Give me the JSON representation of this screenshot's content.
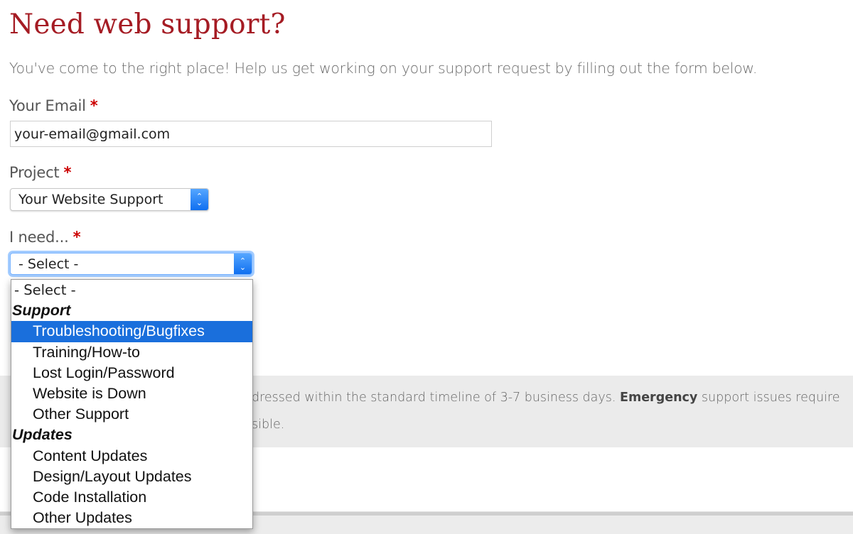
{
  "page": {
    "title": "Need web support?",
    "intro": "You've come to the right place! Help us get working on your support request by filling out the form below."
  },
  "form": {
    "email": {
      "label": "Your Email",
      "required_marker": "*",
      "value": "your-email@gmail.com"
    },
    "project": {
      "label": "Project",
      "required_marker": "*",
      "selected": "Your Website Support"
    },
    "need": {
      "label": "I need...",
      "required_marker": "*",
      "selected": "- Select -",
      "dropdown_open": true,
      "highlighted": "Troubleshooting/Bugfixes",
      "options": [
        {
          "type": "option",
          "label": "- Select -"
        },
        {
          "type": "group",
          "label": "Support"
        },
        {
          "type": "option",
          "label": "Troubleshooting/Bugfixes"
        },
        {
          "type": "option",
          "label": "Training/How-to"
        },
        {
          "type": "option",
          "label": "Lost Login/Password"
        },
        {
          "type": "option",
          "label": "Website is Down"
        },
        {
          "type": "option",
          "label": "Other Support"
        },
        {
          "type": "group",
          "label": "Updates"
        },
        {
          "type": "option",
          "label": "Content Updates"
        },
        {
          "type": "option",
          "label": "Design/Layout Updates"
        },
        {
          "type": "option",
          "label": "Code Installation"
        },
        {
          "type": "option",
          "label": "Other Updates"
        }
      ]
    }
  },
  "notice": {
    "line1_pre": "dressed within the standard timeline of 3-7 business days. ",
    "line1_bold": "Emergency",
    "line1_post": " support issues require",
    "line2": "sible."
  },
  "colors": {
    "title": "#a51c24",
    "required": "#cc0000",
    "highlight": "#1a6fdc",
    "select_arrow": "#1a7ff5"
  }
}
